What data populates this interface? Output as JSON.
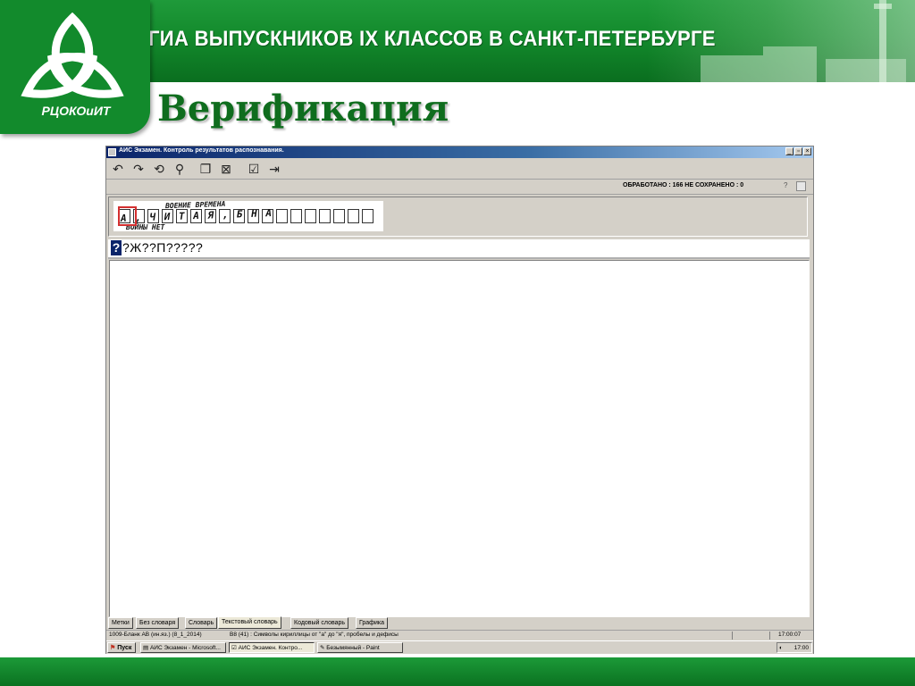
{
  "slide": {
    "logo_text": "РЦОКОиИТ",
    "header_title": "ГИА ВЫПУСКНИКОВ IX КЛАССОВ В САНКТ-ПЕТЕРБУРГЕ",
    "title": "Верификация",
    "colors": {
      "banner": "#138a2c",
      "title": "#0f6d1e"
    }
  },
  "app": {
    "window_title": "АИС Экзамен. Контроль результатов распознавания.",
    "window_buttons": [
      "_",
      "▫",
      "×"
    ],
    "toolbar_icons": [
      "undo-icon",
      "redo-icon",
      "refresh-icon",
      "zoom-icon",
      "copy-icon",
      "delete-icon",
      "accept-icon",
      "exit-icon"
    ],
    "counters": "ОБРАБОТАНО : 166   НЕ СОХРАНЕНО : 0",
    "help": "?",
    "scan_letters": "А , Ч И Т А Я , Б Н А",
    "scan_top_text": "ВОЕНИЕ ВРЕМЕНА",
    "scan_bottom_text": "ВОЙНЫ НЕТ",
    "answer_cursor": "?",
    "answer_text": "?Ж??П?????",
    "tabs": [
      "Метки",
      "Без словаря",
      "Словарь",
      "Текстовый словарь",
      "Кодовый словарь",
      "Графика"
    ],
    "active_tab": "Текстовый словарь",
    "status_left": "1009-Бланк АВ (ин.яз.) (8_1_2014)",
    "status_mid": "В8 (41) : Символы кириллицы от \"а\" до \"я\", пробелы и дефисы",
    "status_time": "17:00:07"
  },
  "taskbar": {
    "start_label": "Пуск",
    "tasks": [
      "АИС Экзамен - Microsoft...",
      "АИС Экзамен. Контро...",
      "Безымянный - Paint"
    ],
    "clock": "17:00"
  }
}
